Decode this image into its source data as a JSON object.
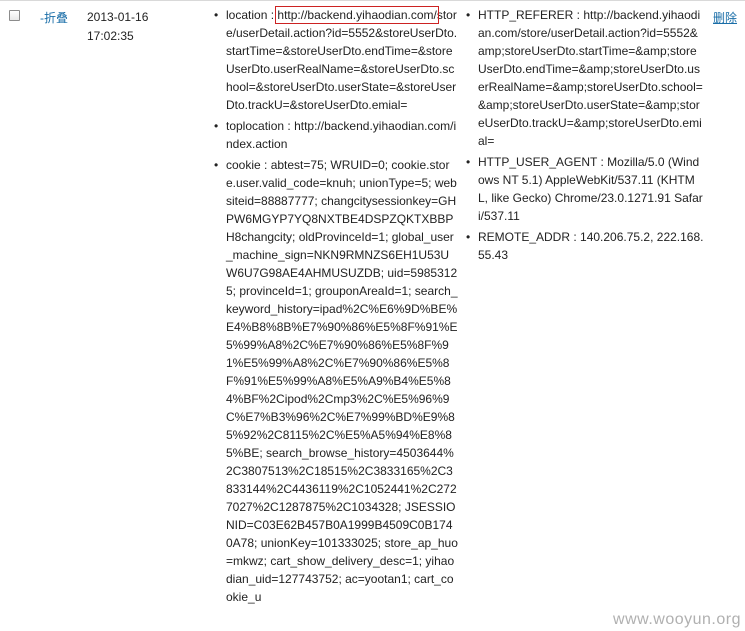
{
  "row": {
    "fold_label": "-折叠",
    "date": "2013-01-16",
    "time": "17:02:35",
    "delete_label": "删除"
  },
  "request_fields": [
    {
      "key": "location",
      "value_highlight": "http://backend.yihaodian.com/",
      "value_rest": "store/userDetail.action?id=5552&storeUserDto.startTime=&storeUserDto.endTime=&storeUserDto.userRealName=&storeUserDto.school=&storeUserDto.userState=&storeUserDto.trackU=&storeUserDto.emial="
    },
    {
      "key": "toplocation",
      "value": "http://backend.yihaodian.com/index.action"
    },
    {
      "key": "cookie",
      "value": "abtest=75; WRUID=0; cookie.store.user.valid_code=knuh; unionType=5; websiteid=88887777; changcitysessionkey=GHPW6MGYP7YQ8NXTBE4DSPZQKTXBBPH8changcity; oldProvinceId=1; global_user_machine_sign=NKN9RMNZS6EH1U53UW6U7G98AE4AHMUSUZDB; uid=59853125; provinceId=1; grouponAreaId=1; search_keyword_history=ipad%2C%E6%9D%BE%E4%B8%8B%E7%90%86%E5%8F%91%E5%99%A8%2C%E7%90%86%E5%8F%91%E5%99%A8%2C%E7%90%86%E5%8F%91%E5%99%A8%E5%A9%B4%E5%84%BF%2Cipod%2Cmp3%2C%E5%96%9C%E7%B3%96%2C%E7%99%BD%E9%85%92%2C8115%2C%E5%A5%94%E8%85%BE; search_browse_history=4503644%2C3807513%2C18515%2C3833165%2C3833144%2C4436119%2C1052441%2C2727027%2C1287875%2C1034328; JSESSIONID=C03E62B457B0A1999B4509C0B1740A78; unionKey=101333025; store_ap_huo=mkwz; cart_show_delivery_desc=1; yihaodian_uid=127743752; ac=yootan1; cart_cookie_u"
    }
  ],
  "header_fields": [
    {
      "key": "HTTP_REFERER",
      "value": "http://backend.yihaodian.com/store/userDetail.action?id=5552&amp;storeUserDto.startTime=&amp;storeUserDto.endTime=&amp;storeUserDto.userRealName=&amp;storeUserDto.school=&amp;storeUserDto.userState=&amp;storeUserDto.trackU=&amp;storeUserDto.emial="
    },
    {
      "key": "HTTP_USER_AGENT",
      "value": "Mozilla/5.0 (Windows NT 5.1) AppleWebKit/537.11 (KHTML, like Gecko) Chrome/23.0.1271.91 Safari/537.11"
    },
    {
      "key": "REMOTE_ADDR",
      "value": "140.206.75.2, 222.168.55.43"
    }
  ],
  "watermark": "www.wooyun.org"
}
